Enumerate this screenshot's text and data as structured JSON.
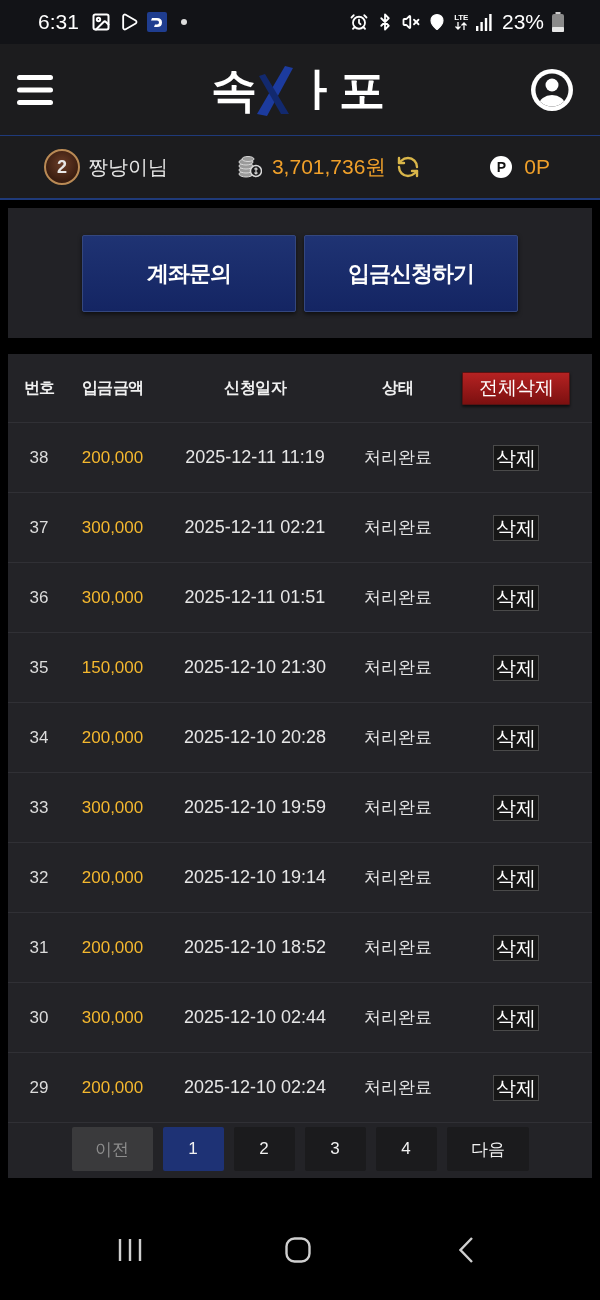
{
  "status_bar": {
    "time": "6:31",
    "network": "LTE",
    "battery": "23%"
  },
  "header": {
    "logo_left": "속",
    "logo_right": "ㅏ포"
  },
  "user_bar": {
    "level": "2",
    "username": "짱낭이님",
    "balance": "3,701,736원",
    "points_badge": "P",
    "points": "0P"
  },
  "actions": [
    "계좌문의",
    "입금신청하기"
  ],
  "table": {
    "columns": [
      "번호",
      "입금금액",
      "신청일자",
      "상태"
    ],
    "delete_all": "전체삭제",
    "rows": [
      {
        "no": "38",
        "amount": "200,000",
        "date": "2025-12-11 11:19",
        "status": "처리완료",
        "action": "삭제"
      },
      {
        "no": "37",
        "amount": "300,000",
        "date": "2025-12-11 02:21",
        "status": "처리완료",
        "action": "삭제"
      },
      {
        "no": "36",
        "amount": "300,000",
        "date": "2025-12-11 01:51",
        "status": "처리완료",
        "action": "삭제"
      },
      {
        "no": "35",
        "amount": "150,000",
        "date": "2025-12-10 21:30",
        "status": "처리완료",
        "action": "삭제"
      },
      {
        "no": "34",
        "amount": "200,000",
        "date": "2025-12-10 20:28",
        "status": "처리완료",
        "action": "삭제"
      },
      {
        "no": "33",
        "amount": "300,000",
        "date": "2025-12-10 19:59",
        "status": "처리완료",
        "action": "삭제"
      },
      {
        "no": "32",
        "amount": "200,000",
        "date": "2025-12-10 19:14",
        "status": "처리완료",
        "action": "삭제"
      },
      {
        "no": "31",
        "amount": "200,000",
        "date": "2025-12-10 18:52",
        "status": "처리완료",
        "action": "삭제"
      },
      {
        "no": "30",
        "amount": "300,000",
        "date": "2025-12-10 02:44",
        "status": "처리완료",
        "action": "삭제"
      },
      {
        "no": "29",
        "amount": "200,000",
        "date": "2025-12-10 02:24",
        "status": "처리완료",
        "action": "삭제"
      }
    ]
  },
  "pagination": {
    "prev": {
      "label": "이전",
      "disabled": true
    },
    "pages": [
      {
        "label": "1",
        "selected": true
      },
      {
        "label": "2",
        "selected": false
      },
      {
        "label": "3",
        "selected": false
      },
      {
        "label": "4",
        "selected": false
      }
    ],
    "next": {
      "label": "다음",
      "disabled": false
    }
  }
}
